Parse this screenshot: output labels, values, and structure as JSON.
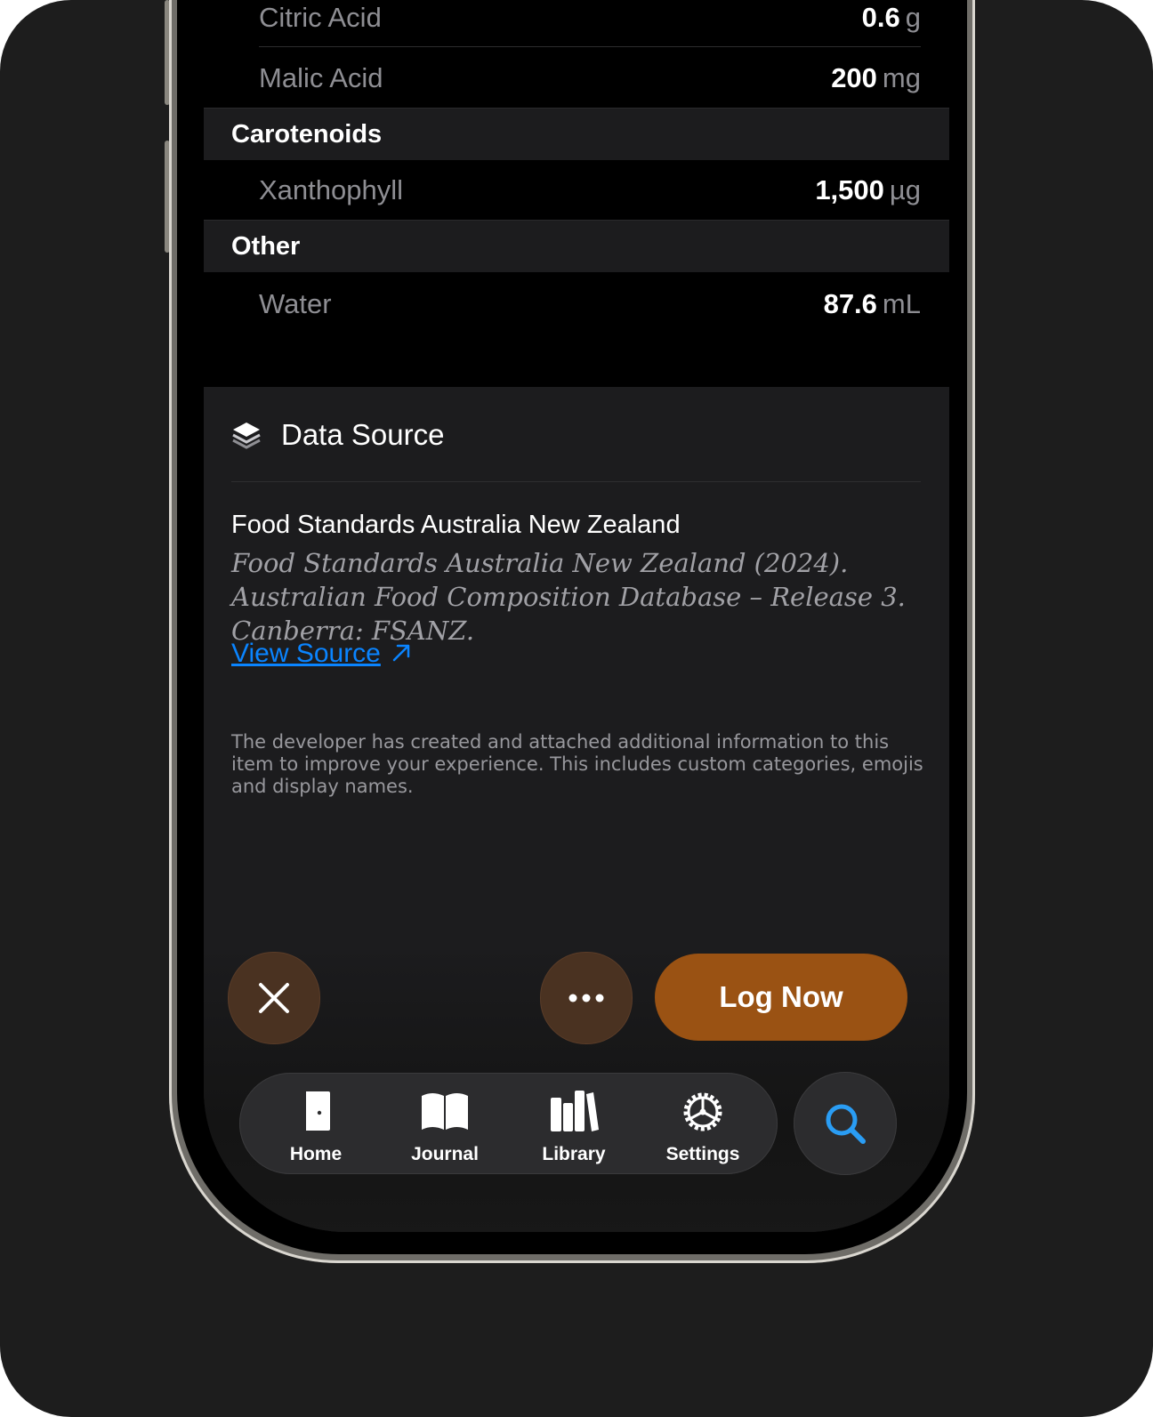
{
  "nutrients": {
    "rows_top": [
      {
        "name": "Citric Acid",
        "value": "0.6",
        "unit": "g"
      },
      {
        "name": "Malic Acid",
        "value": "200",
        "unit": "mg"
      }
    ],
    "sections": [
      {
        "title": "Carotenoids",
        "rows": [
          {
            "name": "Xanthophyll",
            "value": "1,500",
            "unit": "µg"
          }
        ]
      },
      {
        "title": "Other",
        "rows": [
          {
            "name": "Water",
            "value": "87.6",
            "unit": "mL"
          }
        ]
      }
    ]
  },
  "data_source": {
    "heading": "Data Source",
    "icon": "stack-layers-icon",
    "source_name": "Food Standards Australia New Zealand",
    "citation": "Food Standards Australia New Zealand (2024). Australian Food Composition Database – Release 3. Canberra: FSANZ.",
    "link_label": "View Source",
    "disclaimer": "The developer has created and attached additional information to this item to improve your experience. This includes custom categories, emojis and display names."
  },
  "actions": {
    "close_icon": "close-icon",
    "more_icon": "more-icon",
    "log_label": "Log Now",
    "accent": "#9a5213"
  },
  "tabbar": {
    "tabs": [
      {
        "label": "Home",
        "icon": "door-icon"
      },
      {
        "label": "Journal",
        "icon": "book-icon"
      },
      {
        "label": "Library",
        "icon": "books-icon"
      },
      {
        "label": "Settings",
        "icon": "gear-icon"
      }
    ],
    "search_icon": "search-icon",
    "search_color": "#2a9df4"
  }
}
